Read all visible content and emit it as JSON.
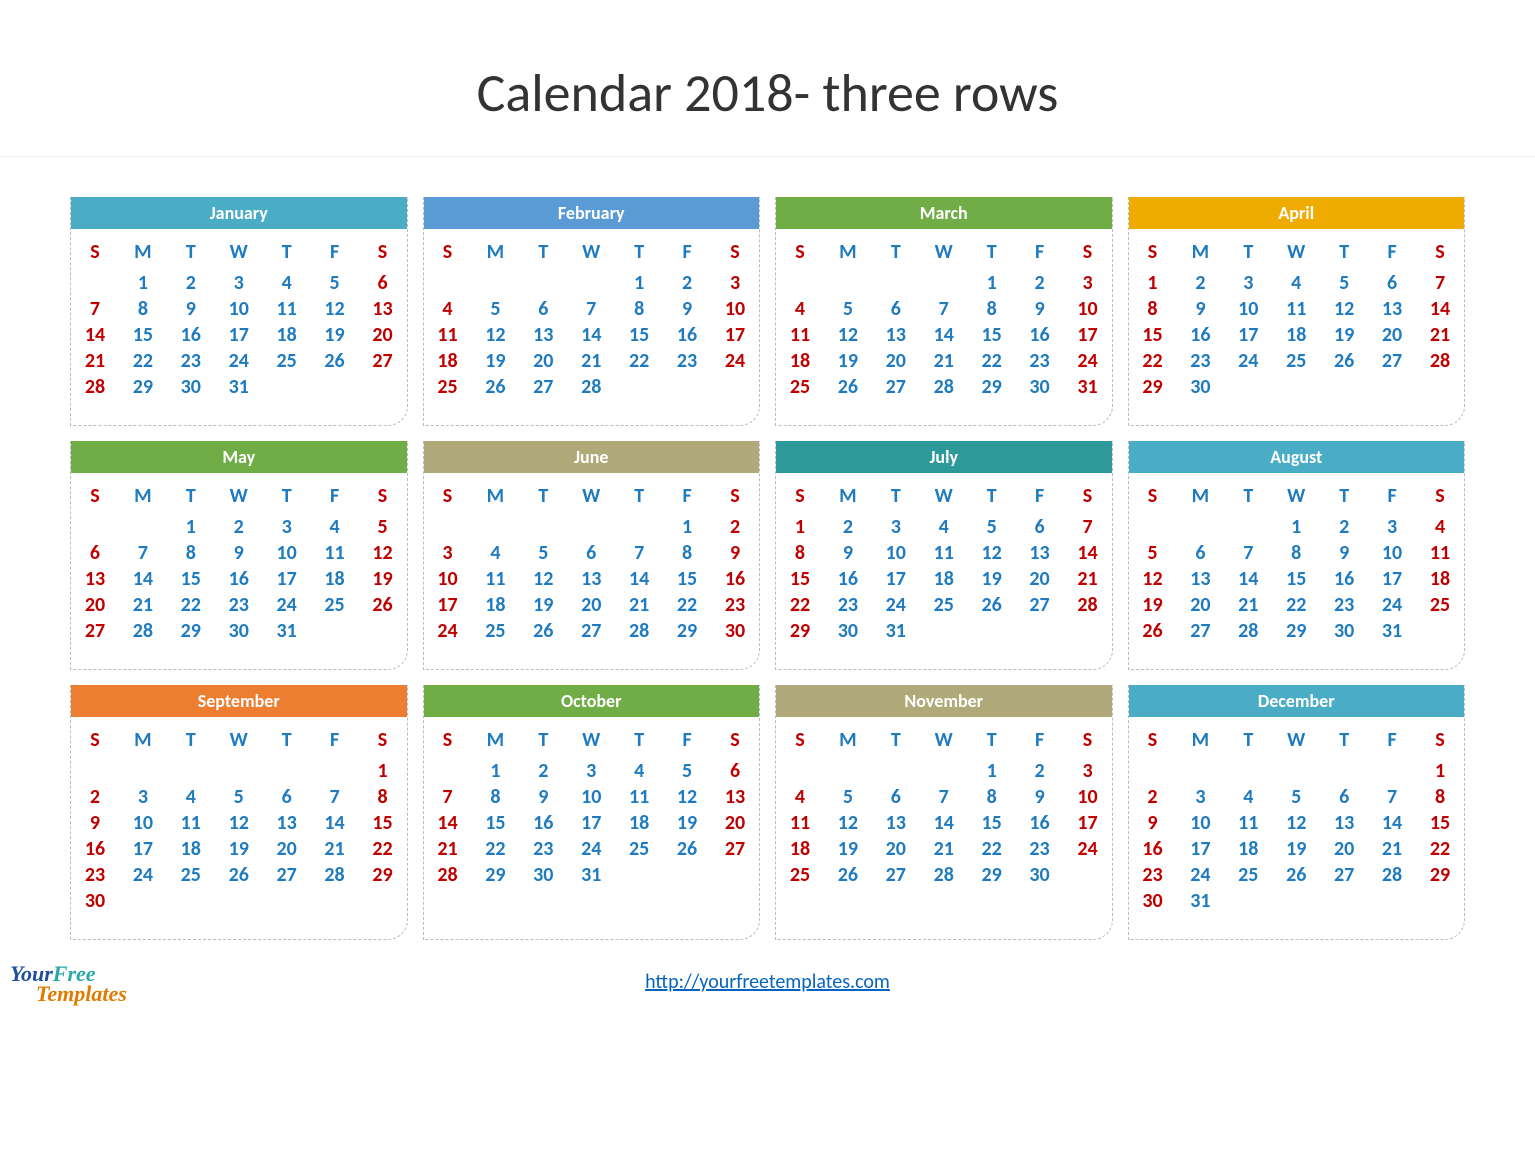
{
  "title": "Calendar 2018- three rows",
  "dow": [
    "S",
    "M",
    "T",
    "W",
    "T",
    "F",
    "S"
  ],
  "footer_url": "http://yourfreetemplates.com",
  "logo": {
    "your": "Your",
    "free": "Free",
    "templates": "Templates"
  },
  "months": [
    {
      "name": "January",
      "color": "c-teal",
      "start": 1,
      "days": 31
    },
    {
      "name": "February",
      "color": "c-blue",
      "start": 4,
      "days": 28
    },
    {
      "name": "March",
      "color": "c-green",
      "start": 4,
      "days": 31
    },
    {
      "name": "April",
      "color": "c-gold",
      "start": 0,
      "days": 30
    },
    {
      "name": "May",
      "color": "c-green",
      "start": 2,
      "days": 31
    },
    {
      "name": "June",
      "color": "c-olive",
      "start": 5,
      "days": 30
    },
    {
      "name": "July",
      "color": "c-dteal",
      "start": 0,
      "days": 31
    },
    {
      "name": "August",
      "color": "c-teal",
      "start": 3,
      "days": 31
    },
    {
      "name": "September",
      "color": "c-orange",
      "start": 6,
      "days": 30
    },
    {
      "name": "October",
      "color": "c-green",
      "start": 1,
      "days": 31
    },
    {
      "name": "November",
      "color": "c-olive",
      "start": 4,
      "days": 30
    },
    {
      "name": "December",
      "color": "c-teal",
      "start": 6,
      "days": 31
    }
  ]
}
